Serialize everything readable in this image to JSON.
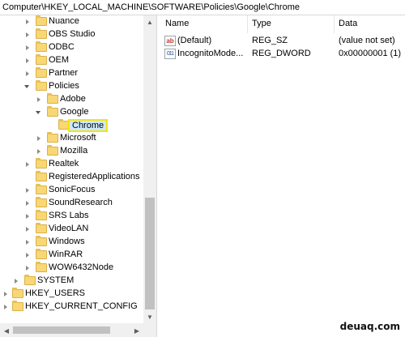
{
  "address_bar": {
    "path": "Computer\\HKEY_LOCAL_MACHINE\\SOFTWARE\\Policies\\Google\\Chrome"
  },
  "tree": {
    "items": [
      {
        "label": "Nuance",
        "state": "collapsed"
      },
      {
        "label": "OBS Studio",
        "state": "collapsed"
      },
      {
        "label": "ODBC",
        "state": "collapsed"
      },
      {
        "label": "OEM",
        "state": "collapsed"
      },
      {
        "label": "Partner",
        "state": "collapsed"
      },
      {
        "label": "Policies",
        "state": "expanded"
      },
      {
        "label": "Adobe",
        "state": "collapsed"
      },
      {
        "label": "Google",
        "state": "expanded"
      },
      {
        "label": "Chrome",
        "state": "selected"
      },
      {
        "label": "Microsoft",
        "state": "collapsed"
      },
      {
        "label": "Mozilla",
        "state": "collapsed"
      },
      {
        "label": "Realtek",
        "state": "collapsed"
      },
      {
        "label": "RegisteredApplications",
        "state": "none"
      },
      {
        "label": "SonicFocus",
        "state": "collapsed"
      },
      {
        "label": "SoundResearch",
        "state": "collapsed"
      },
      {
        "label": "SRS Labs",
        "state": "collapsed"
      },
      {
        "label": "VideoLAN",
        "state": "collapsed"
      },
      {
        "label": "Windows",
        "state": "collapsed"
      },
      {
        "label": "WinRAR",
        "state": "collapsed"
      },
      {
        "label": "WOW6432Node",
        "state": "collapsed"
      },
      {
        "label": "SYSTEM",
        "state": "collapsed"
      },
      {
        "label": "HKEY_USERS",
        "state": "collapsed"
      },
      {
        "label": "HKEY_CURRENT_CONFIG",
        "state": "collapsed"
      }
    ]
  },
  "list": {
    "columns": {
      "name": "Name",
      "type": "Type",
      "data": "Data"
    },
    "rows": [
      {
        "icon": "string-value-icon",
        "icon_glyph": "ab",
        "name": "(Default)",
        "type": "REG_SZ",
        "data": "(value not set)"
      },
      {
        "icon": "dword-value-icon",
        "icon_glyph": "011",
        "name": "IncognitoMode...",
        "type": "REG_DWORD",
        "data": "0x00000001 (1)"
      }
    ]
  },
  "scrollbars": {
    "up_arrow": "▲",
    "down_arrow": "▼",
    "left_arrow": "◀",
    "right_arrow": "▶"
  },
  "watermark": {
    "text": "deuaq.com"
  },
  "colors": {
    "selection": "#cce8ff",
    "highlight_border": "#f5e50a",
    "folder": "#f8d775"
  }
}
